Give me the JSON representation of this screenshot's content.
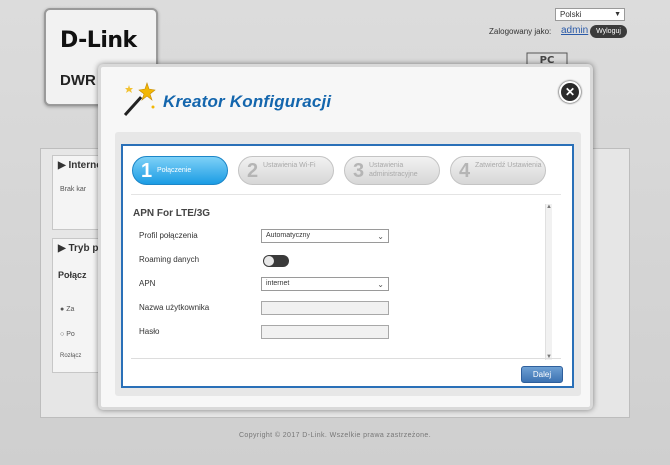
{
  "header": {
    "logo": "D-Link",
    "model_partial": "DWR",
    "language": "Polski",
    "login_label": "Zalogowany jako:",
    "user": "admin",
    "logout": "Wyloguj"
  },
  "background": {
    "section1_title": "Interne",
    "section1_text": "Brak kar",
    "section2_title": "Tryb p",
    "section2_sub": "Połącz",
    "radio1": "Za",
    "radio2": "Po",
    "misc": "Rozłącz"
  },
  "footer": {
    "copyright": "Copyright © 2017 D-Link. Wszelkie prawa zastrzeżone."
  },
  "wizard": {
    "title": "Kreator Konfiguracji",
    "steps": [
      {
        "num": "1",
        "label": "Połączenie",
        "active": true
      },
      {
        "num": "2",
        "label": "Ustawienia Wi-Fi",
        "active": false
      },
      {
        "num": "3",
        "label": "Ustawienia administracyjne",
        "active": false
      },
      {
        "num": "4",
        "label": "Zatwierdź Ustawienia",
        "active": false
      }
    ],
    "section_title": "APN For LTE/3G",
    "fields": {
      "profile_label": "Profil połączenia",
      "profile_value": "Automatyczny",
      "roaming_label": "Roaming danych",
      "apn_label": "APN",
      "apn_value": "internet",
      "username_label": "Nazwa użytkownika",
      "username_value": "",
      "password_label": "Hasło",
      "password_value": ""
    },
    "next_button": "Dalej"
  },
  "colors": {
    "title_blue": "#1466ad",
    "active_step": "#1b9ce4",
    "frame_border": "#2a70b8",
    "button_blue": "#3c72b2"
  }
}
